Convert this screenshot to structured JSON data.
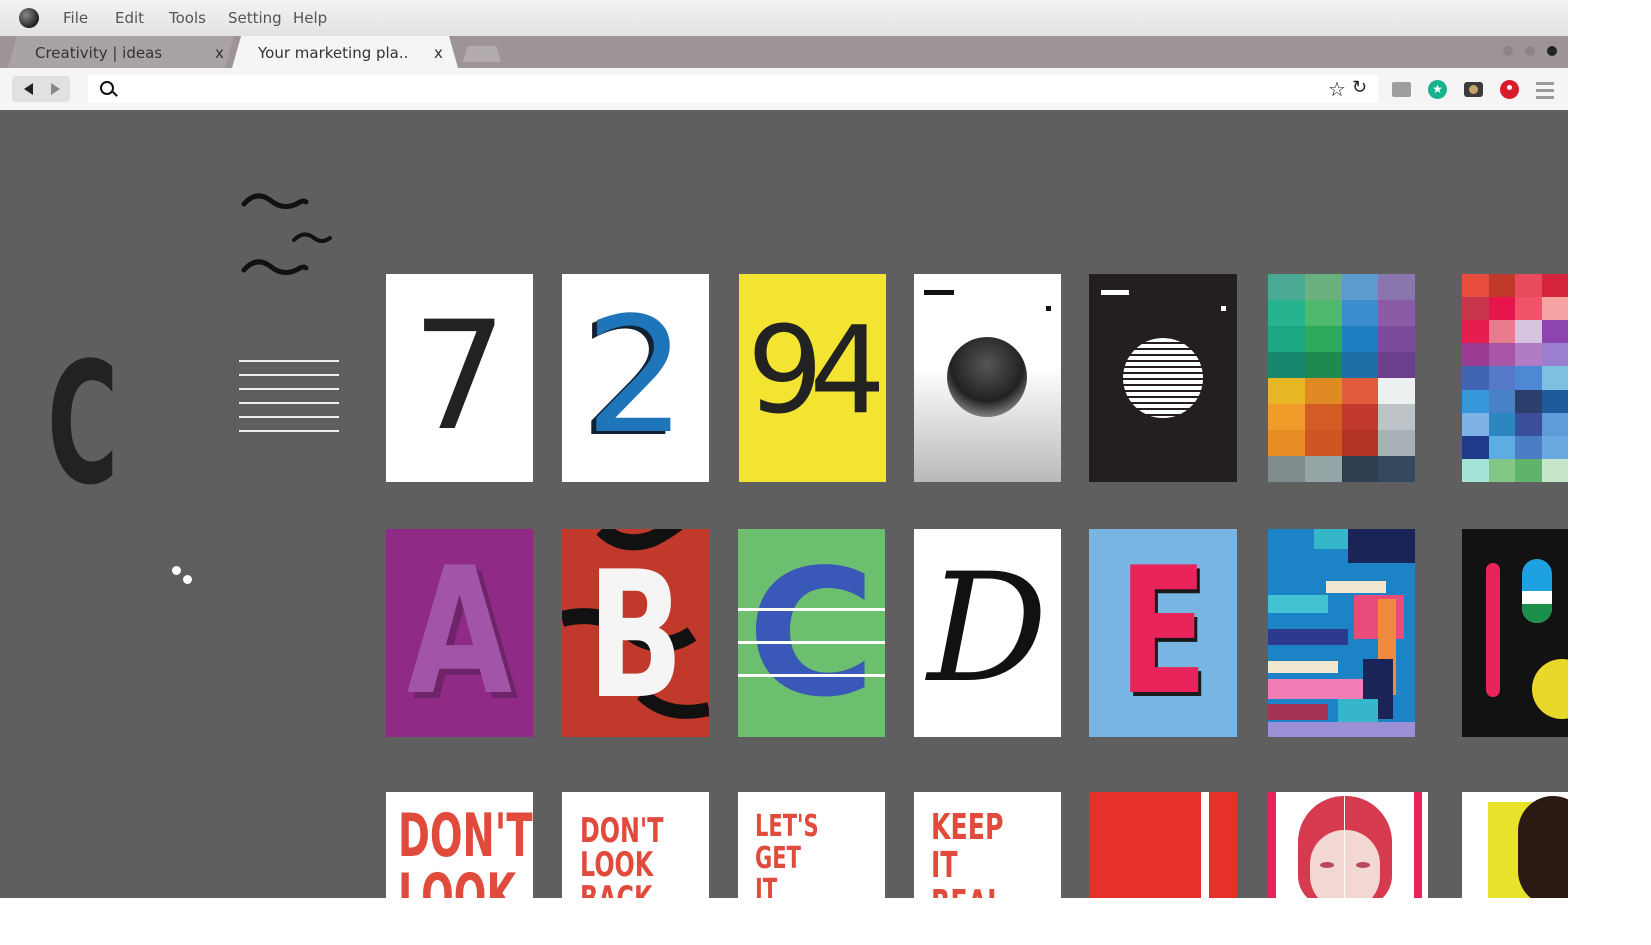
{
  "menubar": {
    "items": [
      "File",
      "Edit",
      "Tools",
      "Setting",
      "Help"
    ]
  },
  "tabs": [
    {
      "label": "Creativity  |  ideas",
      "close": "x"
    },
    {
      "label": "Your marketing pla..",
      "close": "x"
    }
  ],
  "addressbar": {
    "value": "",
    "placeholder": ""
  },
  "gallery": {
    "row1": [
      "7",
      "2",
      "94"
    ],
    "row2": [
      "A",
      "B",
      "C",
      "D",
      "E"
    ],
    "row3": [
      {
        "lines": [
          "DON'T",
          "LOOK"
        ]
      },
      {
        "lines": [
          "DON'T",
          "LOOK",
          "BACK"
        ]
      },
      {
        "lines": [
          "LET'S",
          "GET",
          "IT"
        ]
      },
      {
        "lines": [
          "KEEP",
          "IT",
          "REAL"
        ]
      }
    ]
  },
  "decor": {
    "letter": "C"
  },
  "colors": {
    "accent_red": "#e04b3c",
    "background": "#5f5f5f"
  }
}
